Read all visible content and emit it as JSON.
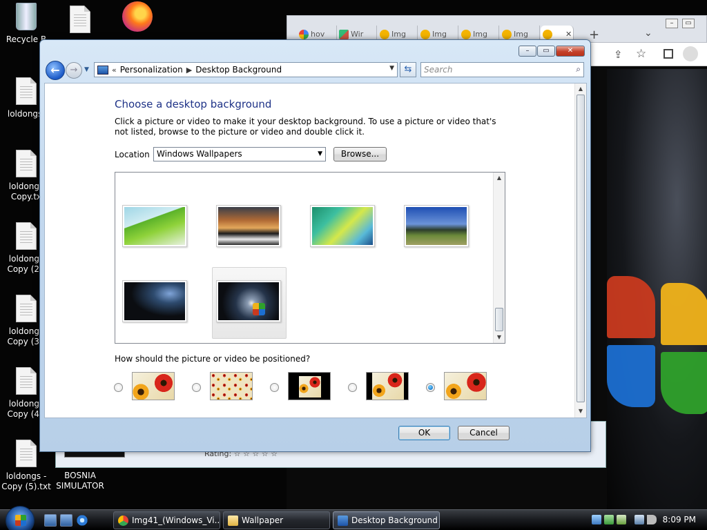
{
  "desktop": {
    "icons": [
      {
        "label": "Recycle B",
        "type": "recycle-bin"
      },
      {
        "label": "",
        "type": "text-file"
      },
      {
        "label": "",
        "type": "firefox"
      },
      {
        "label": "loldongs.",
        "type": "text-file"
      },
      {
        "label": "loldongs Copy.tx",
        "type": "text-file"
      },
      {
        "label": "loldongs Copy (2).",
        "type": "text-file"
      },
      {
        "label": "loldongs Copy (3).",
        "type": "text-file"
      },
      {
        "label": "loldongs Copy (4).",
        "type": "text-file"
      },
      {
        "label": "loldongs - Copy (5).txt",
        "type": "text-file"
      },
      {
        "label": "BOSNIA SIMULATOR",
        "type": "app"
      }
    ]
  },
  "chrome": {
    "tabs": [
      {
        "label": "hov",
        "favicon": "google"
      },
      {
        "label": "Wir",
        "favicon": "wikimedia"
      },
      {
        "label": "Img",
        "favicon": "flower"
      },
      {
        "label": "Img",
        "favicon": "flower"
      },
      {
        "label": "Img",
        "favicon": "flower"
      },
      {
        "label": "Img",
        "favicon": "flower"
      },
      {
        "label": "",
        "favicon": "flower"
      }
    ],
    "new_tab": "+",
    "tab_search": "⌄",
    "close_tab": "✕"
  },
  "behind_window": {
    "rating_text": "Rating: ☆ ☆ ☆ ☆ ☆"
  },
  "dialog": {
    "controls": {
      "minimize": "–",
      "maximize": "▭",
      "close": "✕"
    },
    "breadcrumb": {
      "overflow": "«",
      "items": [
        "Personalization",
        "Desktop Background"
      ]
    },
    "search_placeholder": "Search",
    "heading": "Choose a desktop background",
    "description": "Click a picture or video to make it your desktop background. To use a picture or video that's not listed, browse to the picture or video and double click it.",
    "location_label": "Location",
    "location_value": "Windows Wallpapers",
    "browse_label": "Browse...",
    "wallpapers": [
      {
        "name": "palm-leaf",
        "selected": false
      },
      {
        "name": "mountain-lake",
        "selected": false
      },
      {
        "name": "aurora-green",
        "selected": false
      },
      {
        "name": "tree-field",
        "selected": false
      },
      {
        "name": "aurora-dark",
        "selected": false
      },
      {
        "name": "windows-flag",
        "selected": true
      }
    ],
    "position_question": "How should the picture or video be positioned?",
    "position_options": [
      {
        "name": "stretch",
        "selected": false
      },
      {
        "name": "tile",
        "selected": false
      },
      {
        "name": "center",
        "selected": false
      },
      {
        "name": "fit",
        "selected": false
      },
      {
        "name": "fill",
        "selected": true
      }
    ],
    "ok_label": "OK",
    "cancel_label": "Cancel"
  },
  "taskbar": {
    "buttons": [
      {
        "label": "Img41_(Windows_Vi...",
        "icon": "chrome",
        "active": false
      },
      {
        "label": "Wallpaper",
        "icon": "folder",
        "active": false
      },
      {
        "label": "Desktop Background",
        "icon": "personalization",
        "active": true
      }
    ],
    "clock": "8:09 PM"
  }
}
